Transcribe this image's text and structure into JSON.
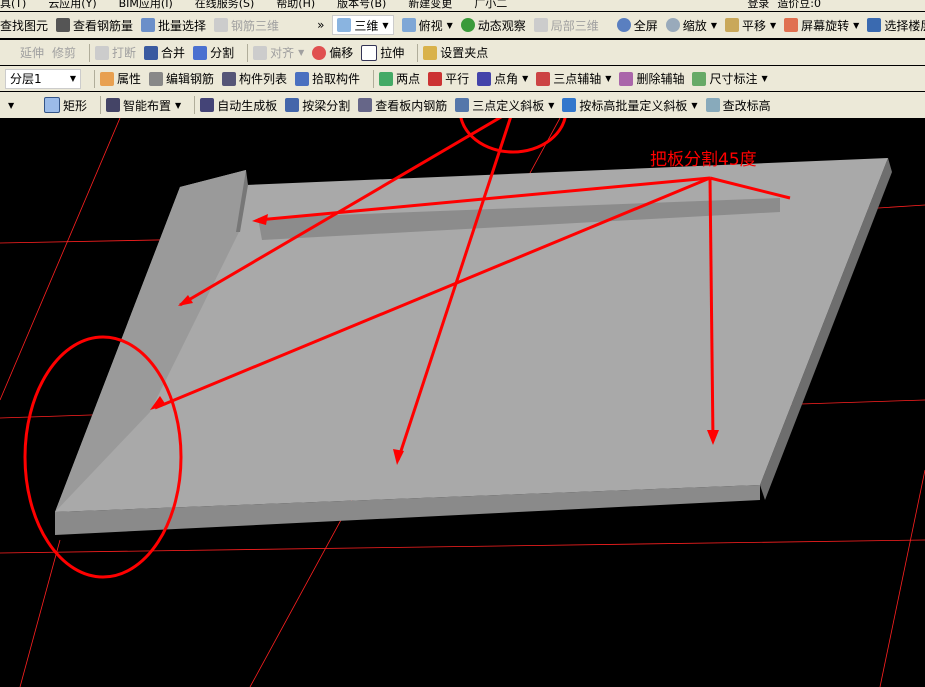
{
  "menu": [
    "具(T)",
    "云应用(Y)",
    "BIM应用(I)",
    "在线服务(S)",
    "帮助(H)",
    "版本号(B)",
    "新建变更",
    "广小二",
    "登录",
    "造价豆:0"
  ],
  "row1": {
    "left": [
      "查找图元",
      "查看钢筋量",
      "批量选择",
      "钢筋三维"
    ],
    "more": "»",
    "view_3d": "三维",
    "view_top": "俯视",
    "right": [
      "动态观察",
      "局部三维",
      "全屏",
      "缩放",
      "平移",
      "屏幕旋转",
      "选择楼层"
    ]
  },
  "row2": [
    "延伸",
    "修剪",
    "打断",
    "合并",
    "分割",
    "对齐",
    "偏移",
    "拉伸",
    "设置夹点"
  ],
  "row3": {
    "layer": "分层1",
    "items": [
      "属性",
      "编辑钢筋",
      "构件列表",
      "拾取构件",
      "两点",
      "平行",
      "点角",
      "三点辅轴",
      "删除辅轴",
      "尺寸标注"
    ]
  },
  "row4": [
    "矩形",
    "智能布置",
    "自动生成板",
    "按梁分割",
    "查看板内钢筋",
    "三点定义斜板",
    "按标高批量定义斜板",
    "查改标高"
  ],
  "annotation": "把板分割45度",
  "colors": {
    "toolbar": "#ece9d8",
    "canvas": "#000000",
    "slab": "#a9a9a9",
    "annotation": "#ff0000",
    "grid": "#ff0000"
  }
}
